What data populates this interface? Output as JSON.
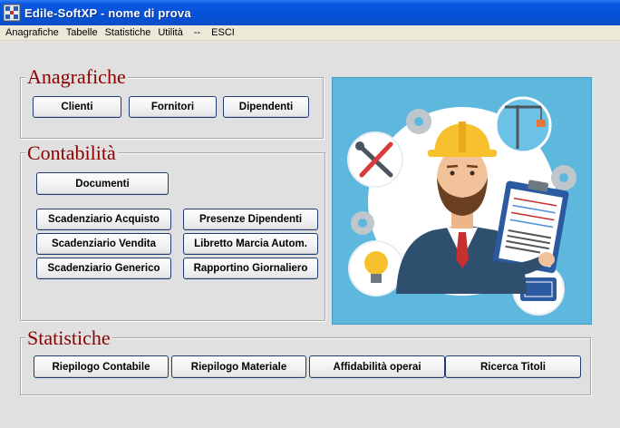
{
  "window": {
    "title": "Edile-SoftXP - nome di prova",
    "icon": "app-grid-icon"
  },
  "menu": {
    "items": [
      "Anagrafiche",
      "Tabelle",
      "Statistiche",
      "Utilità",
      "--",
      "ESCI"
    ]
  },
  "anagrafiche": {
    "title": "Anagrafiche",
    "buttons": [
      "Clienti",
      "Fornitori",
      "Dipendenti"
    ]
  },
  "contabilita": {
    "title": "Contabilità",
    "documenti": "Documenti",
    "left_buttons": [
      "Scadenziario Acquisto",
      "Scadenziario Vendita",
      "Scadenziario Generico"
    ],
    "right_buttons": [
      "Presenze Dipendenti",
      "Libretto Marcia Autom.",
      "Rapportino Giornaliero"
    ]
  },
  "statistiche": {
    "title": "Statistiche",
    "buttons": [
      "Riepilogo Contabile",
      "Riepilogo Materiale",
      "Affidabilità operai",
      "Ricerca Titoli"
    ]
  },
  "illustration": {
    "icons": [
      "gear-icon",
      "crane-icon",
      "tools-icon",
      "lightbulb-icon",
      "blueprint-icon",
      "worker-with-clipboard"
    ]
  },
  "colors": {
    "titlebar": "#0652D8",
    "group_title": "#8B0000",
    "button_border": "#1E3C72",
    "client_bg": "#E0E0E0",
    "illustration_bg": "#5EB8DD"
  }
}
